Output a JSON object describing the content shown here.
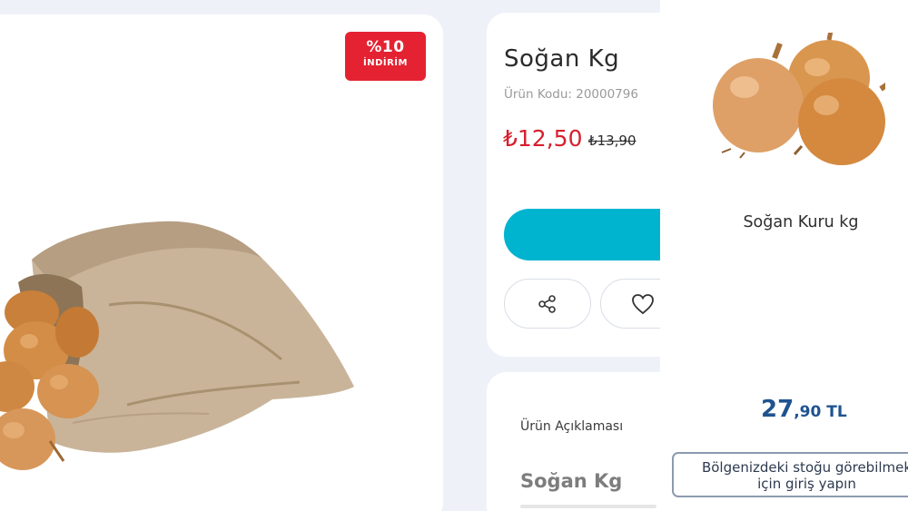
{
  "product": {
    "title": "Soğan Kg",
    "code": "Ürün Kodu: 20000796",
    "price": "₺12,50",
    "old_price": "₺13,90",
    "discount": {
      "percent": "%10",
      "label": "İNDİRİM"
    },
    "description_title": "Ürün Açıklaması",
    "description_heading": "Soğan Kg"
  },
  "overlay_product": {
    "name": "Soğan Kuru kg",
    "price_main": "27",
    "price_decimal": ",90 TL",
    "stock_button_line1": "Bölgenizdeki stoğu görebilmek",
    "stock_button_line2": "için giriş yapın"
  },
  "icons": [
    "share-icon",
    "heart-icon",
    "onion-sack-image",
    "onions-image"
  ],
  "colors": {
    "discount": "#e52231",
    "price": "#d71f2e",
    "cart_button": "#00b4d0",
    "overlay_price": "#1f5390"
  }
}
